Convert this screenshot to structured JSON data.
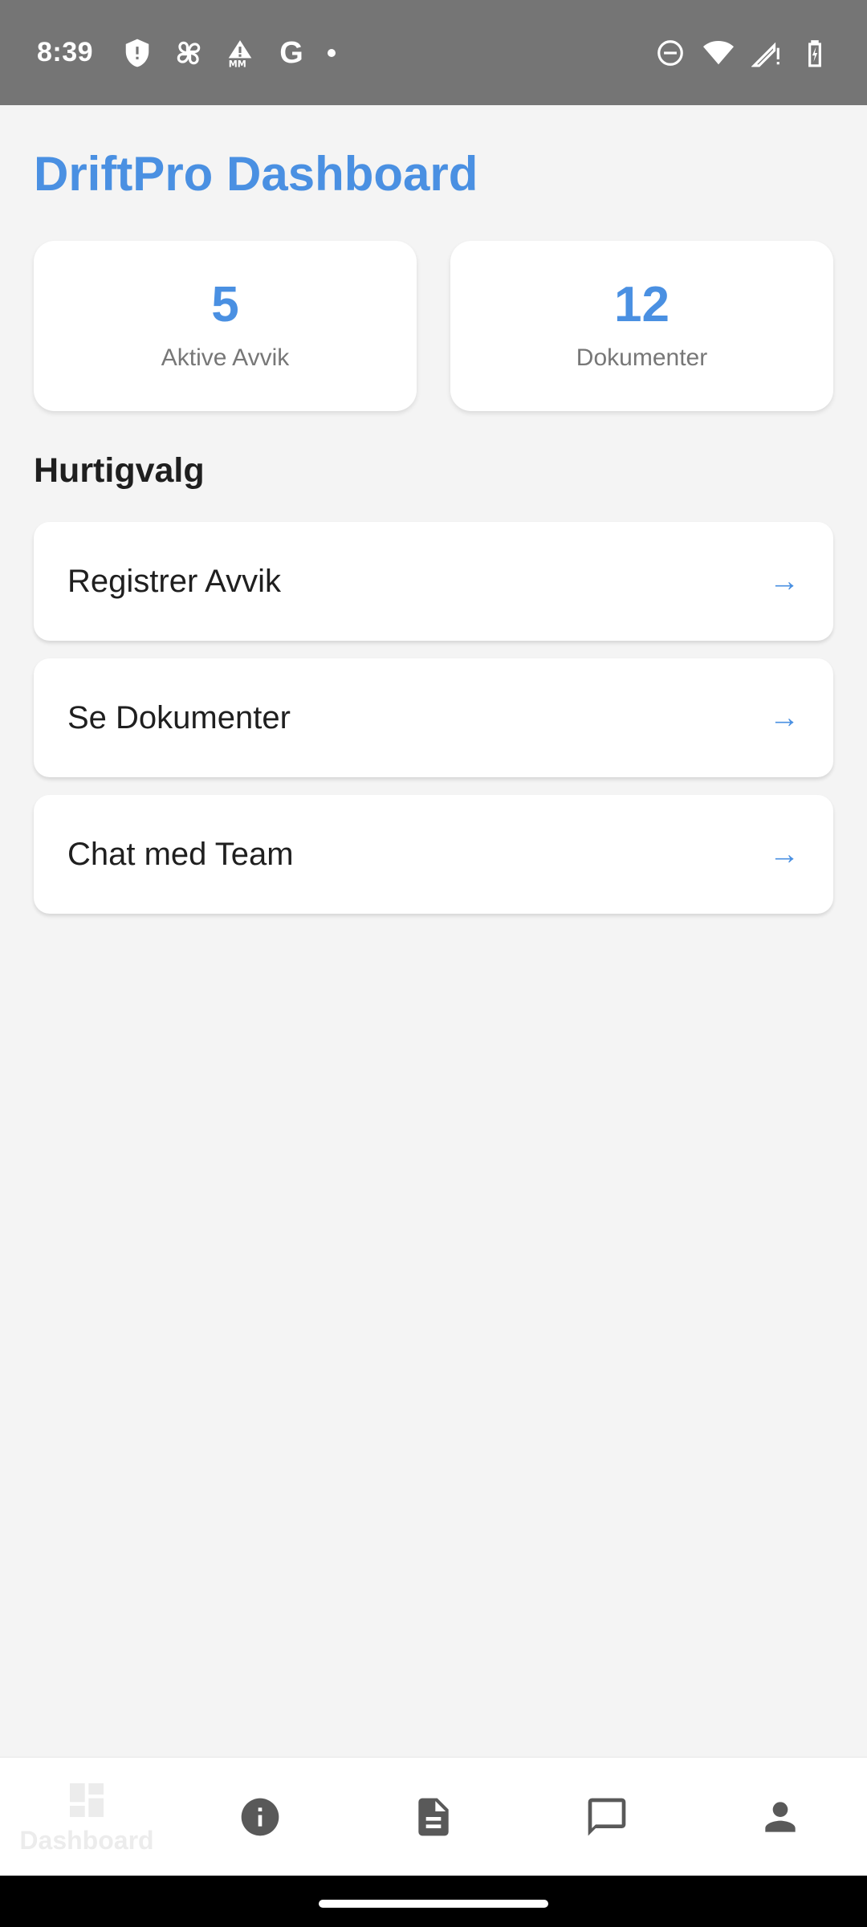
{
  "status_bar": {
    "time": "8:39",
    "g_letter": "G",
    "icons_left": [
      "shield-icon",
      "pinwheel-icon",
      "mm-warning-icon",
      "google-icon",
      "dot-icon"
    ],
    "icons_right": [
      "do-not-disturb-icon",
      "wifi-icon",
      "signal-icon",
      "battery-charging-icon"
    ]
  },
  "header": {
    "title": "DriftPro Dashboard"
  },
  "stats": [
    {
      "value": "5",
      "label": "Aktive Avvik"
    },
    {
      "value": "12",
      "label": "Dokumenter"
    }
  ],
  "quick_actions": {
    "title": "Hurtigvalg",
    "items": [
      {
        "label": "Registrer Avvik",
        "arrow": "→"
      },
      {
        "label": "Se Dokumenter",
        "arrow": "→"
      },
      {
        "label": "Chat med Team",
        "arrow": "→"
      }
    ]
  },
  "bottom_nav": {
    "items": [
      {
        "label": "Dashboard",
        "icon": "dashboard-icon",
        "active": true
      },
      {
        "label": "",
        "icon": "info-icon",
        "active": false
      },
      {
        "label": "",
        "icon": "document-icon",
        "active": false
      },
      {
        "label": "",
        "icon": "chat-icon",
        "active": false
      },
      {
        "label": "",
        "icon": "profile-icon",
        "active": false
      }
    ]
  },
  "colors": {
    "accent": "#4a90e2",
    "background": "#f4f4f4",
    "status_bar": "#757575"
  }
}
